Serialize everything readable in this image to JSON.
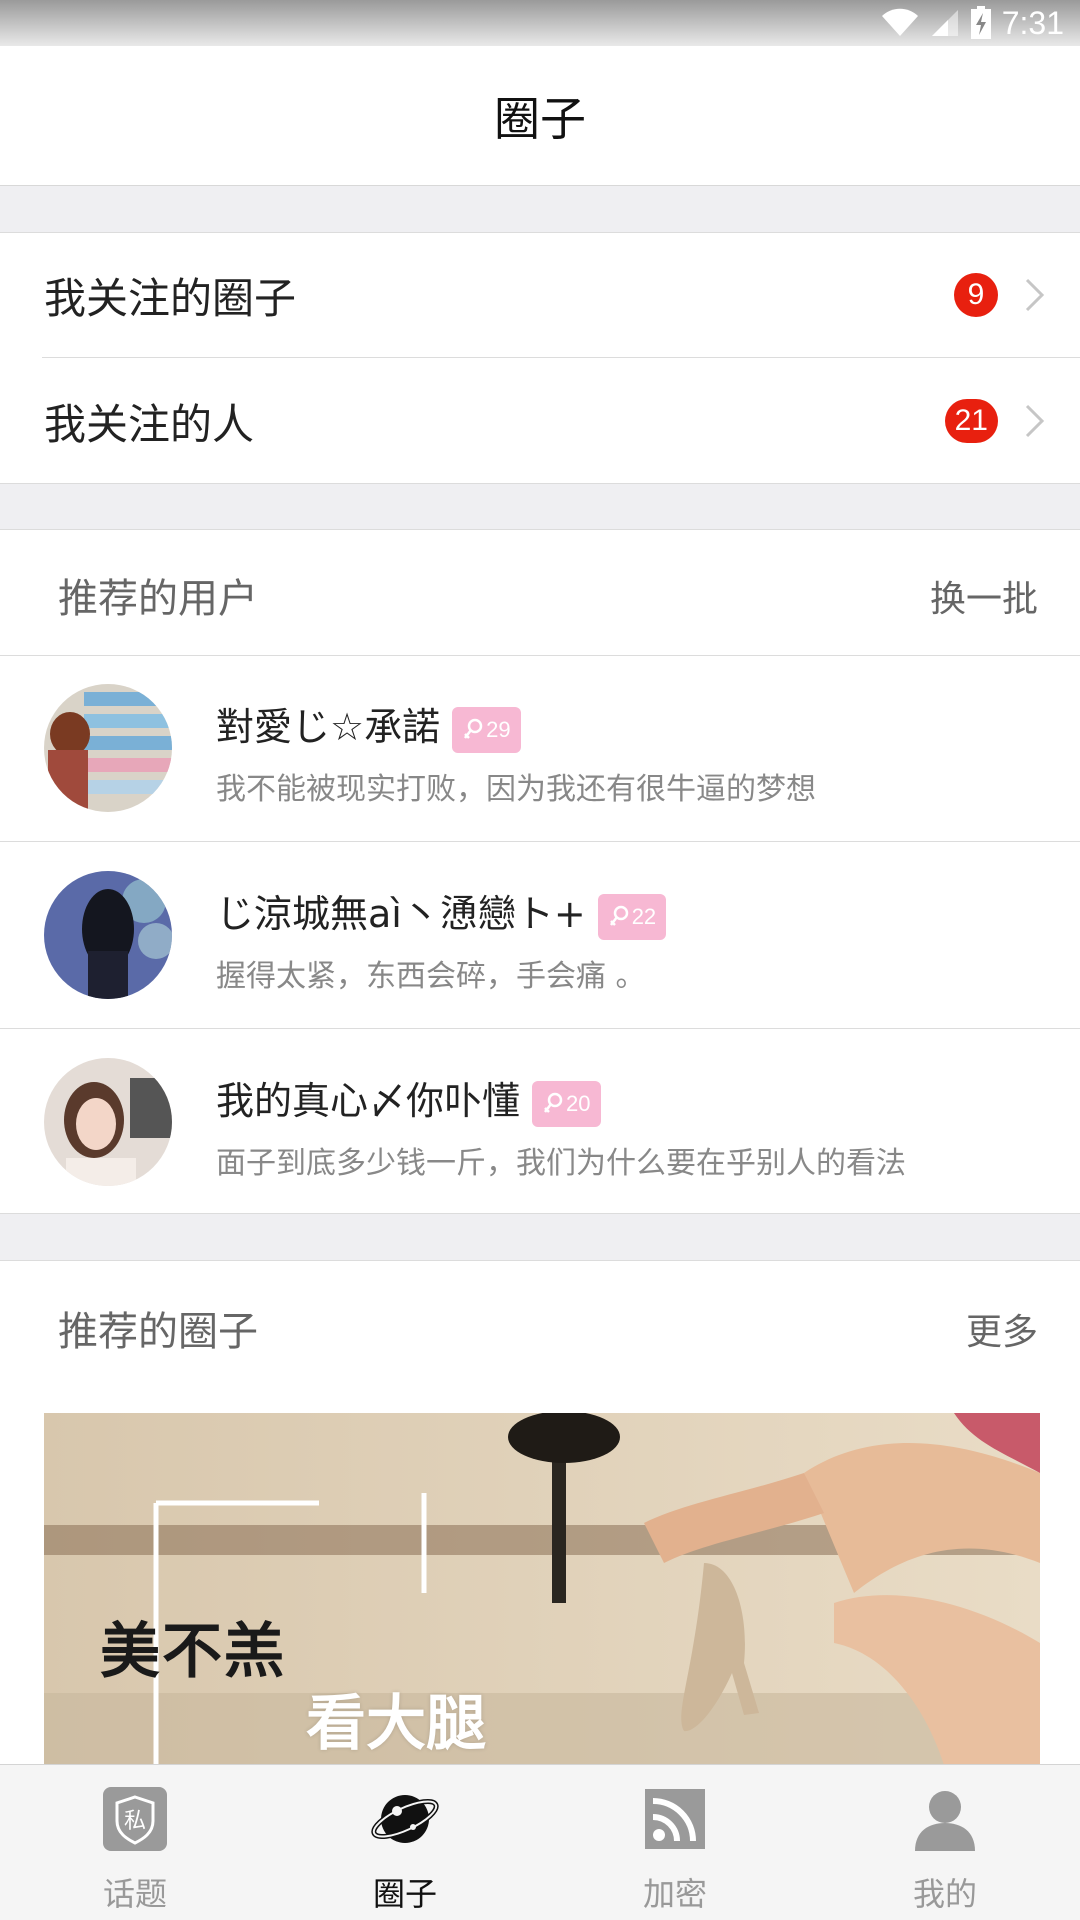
{
  "status_bar": {
    "time": "7:31"
  },
  "header": {
    "title": "圈子"
  },
  "follow": [
    {
      "label": "我关注的圈子",
      "count": "9"
    },
    {
      "label": "我关注的人",
      "count": "21"
    }
  ],
  "recommended_users": {
    "title": "推荐的用户",
    "action": "换一批",
    "users": [
      {
        "name": "對愛じ☆承諾",
        "level": "29",
        "desc": "我不能被现实打败，因为我还有很牛逼的梦想"
      },
      {
        "name": "じ涼城無aì丶慂戀ト+",
        "level": "22",
        "desc": "握得太紧，东西会碎，手会痛 。"
      },
      {
        "name": "我的真心〆你卟懂",
        "level": "20",
        "desc": "面子到底多少钱一斤，我们为什么要在乎别人的看法"
      }
    ]
  },
  "recommended_circles": {
    "title": "推荐的圈子",
    "action": "更多",
    "banner_text_1": "美不羔",
    "banner_text_2": "看大腿"
  },
  "nav": [
    {
      "label": "话题",
      "icon": "private-shield-icon",
      "icon_text": "私"
    },
    {
      "label": "圈子",
      "icon": "planet-icon"
    },
    {
      "label": "加密",
      "icon": "rss-icon"
    },
    {
      "label": "我的",
      "icon": "person-icon"
    }
  ],
  "colors": {
    "badge_red": "#e8200f",
    "level_pink": "#f7b8d3",
    "active_nav": "#111111"
  }
}
